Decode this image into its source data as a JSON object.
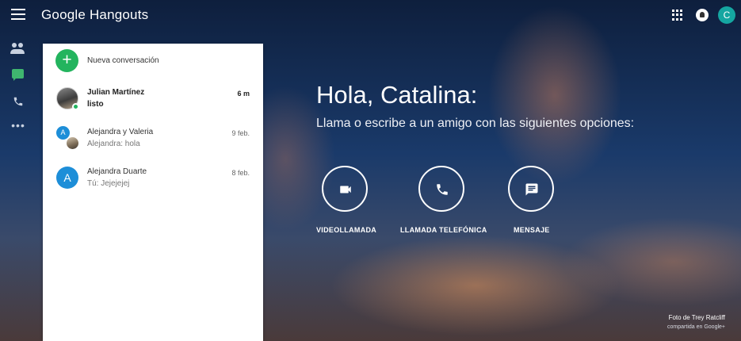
{
  "header": {
    "brand": "Google Hangouts",
    "avatar_letter": "C",
    "icons": [
      "menu-icon",
      "apps-grid-icon",
      "notifications-icon"
    ]
  },
  "rail": {
    "items": [
      {
        "name": "contacts",
        "icon": "people-icon"
      },
      {
        "name": "conversations",
        "icon": "chat-icon",
        "color": "#3fb66f"
      },
      {
        "name": "phone",
        "icon": "phone-icon"
      },
      {
        "name": "more",
        "icon": "more-icon"
      }
    ],
    "more_glyph": "•••"
  },
  "panel": {
    "new_conversation": "Nueva conversación",
    "conversations": [
      {
        "name": "Julian Martínez",
        "message": "listo",
        "time": "6 m",
        "unread": true,
        "online": true
      },
      {
        "name": "Alejandra y Valeria",
        "message": "Alejandra: hola",
        "time": "9 feb.",
        "avatar_letter": "A"
      },
      {
        "name": "Alejandra Duarte",
        "message": "Tú: Jejejejej",
        "time": "8 feb.",
        "avatar_letter": "A"
      }
    ]
  },
  "main": {
    "greeting": "Hola, Catalina:",
    "subtitle": "Llama o escribe a un amigo con las siguientes opciones:",
    "actions": [
      {
        "label": "VIDEOLLAMADA",
        "icon": "video-camera-icon"
      },
      {
        "label": "LLAMADA TELEFÓNICA",
        "icon": "phone-icon"
      },
      {
        "label": "MENSAJE",
        "icon": "message-icon"
      }
    ]
  },
  "credit": {
    "photo": "Foto de Trey Ratcliff",
    "shared": "compartida en Google+"
  },
  "colors": {
    "accent_green": "#23b45e",
    "avatar_teal": "#15a6a1",
    "avatar_blue": "#1d8ed8"
  }
}
